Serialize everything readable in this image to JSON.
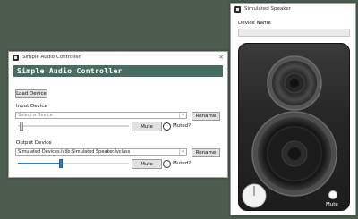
{
  "controller": {
    "title": "Simple Audio Controller",
    "banner": "Simple Audio Controller",
    "load_button": "Load Device",
    "input": {
      "label": "Input Device",
      "placeholder": "Select a Device",
      "rename": "Rename",
      "mute": "Mute",
      "muted_label": "Muted?",
      "volume": 0.02
    },
    "output": {
      "label": "Output Device",
      "value": "Simulated Devices.lvlib:Simulated Speaker.lvclass",
      "rename": "Rename",
      "mute": "Mute",
      "muted_label": "Muted?",
      "volume": 0.37
    }
  },
  "speaker": {
    "title": "Simulated Speaker",
    "device_name_label": "Device Name",
    "device_name_value": "",
    "mute_label": "Mute"
  },
  "icons": {
    "close": "×",
    "dropdown": "▾"
  },
  "colors": {
    "desktop": "#4d5c4f",
    "banner": "#476c60",
    "slider_fill": "#2f7fc4"
  }
}
